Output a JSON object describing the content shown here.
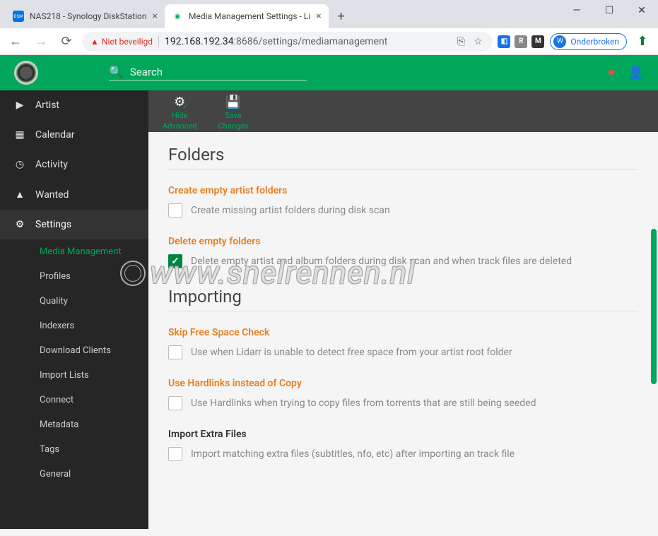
{
  "window": {
    "minimize": "—",
    "maximize": "☐",
    "close": "✕"
  },
  "tabs": [
    {
      "title": "NAS218 - Synology DiskStation",
      "favicon_bg": "#0073e6",
      "favicon_text": "DSM",
      "active": false
    },
    {
      "title": "Media Management Settings - Li",
      "favicon_bg": "#333",
      "favicon_text": "◉",
      "active": true
    }
  ],
  "browser": {
    "security_label": "Niet beveiligd",
    "url_host": "192.168.192.34",
    "url_port": ":8686",
    "url_path": "/settings/mediamanagement",
    "profile_letter": "W",
    "profile_label": "Onderbroken",
    "extensions": [
      {
        "bg": "#1a73e8",
        "text": "◧"
      },
      {
        "bg": "#888",
        "text": "R"
      },
      {
        "bg": "#333",
        "text": "M"
      }
    ]
  },
  "header": {
    "search_placeholder": "Search"
  },
  "sidebar": {
    "items": [
      {
        "icon": "▶",
        "label": "Artist"
      },
      {
        "icon": "▦",
        "label": "Calendar"
      },
      {
        "icon": "◷",
        "label": "Activity"
      },
      {
        "icon": "▲",
        "label": "Wanted"
      },
      {
        "icon": "⚙",
        "label": "Settings"
      }
    ],
    "sub": [
      "Media Management",
      "Profiles",
      "Quality",
      "Indexers",
      "Download Clients",
      "Import Lists",
      "Connect",
      "Metadata",
      "Tags",
      "General"
    ]
  },
  "toolbar": {
    "hide": {
      "line1": "Hide",
      "line2": "Advanced"
    },
    "save": {
      "line1": "Save",
      "line2": "Changes"
    }
  },
  "sections": {
    "folders": {
      "title": "Folders",
      "create": {
        "label": "Create empty artist folders",
        "desc": "Create missing artist folders during disk scan",
        "checked": false
      },
      "delete": {
        "label": "Delete empty folders",
        "desc": "Delete empty artist and album folders during disk scan and when track files are deleted",
        "checked": true
      }
    },
    "importing": {
      "title": "Importing",
      "skip": {
        "label": "Skip Free Space Check",
        "desc": "Use when Lidarr is unable to detect free space from your artist root folder",
        "checked": false
      },
      "hardlinks": {
        "label": "Use Hardlinks instead of Copy",
        "desc": "Use Hardlinks when trying to copy files from torrents that are still being seeded",
        "checked": false
      },
      "extras": {
        "label": "Import Extra Files",
        "desc": "Import matching extra files (subtitles, nfo, etc) after importing an track file",
        "checked": false
      }
    }
  },
  "watermark": "www.snelrennen.nl"
}
